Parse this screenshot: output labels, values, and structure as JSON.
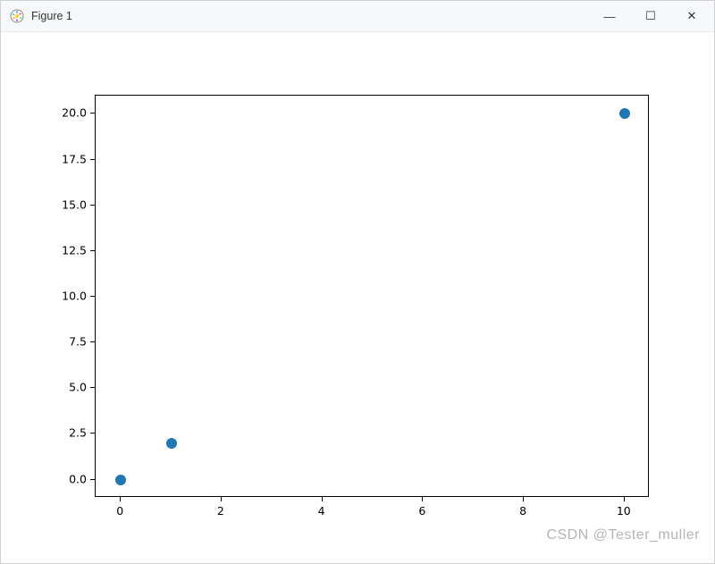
{
  "window": {
    "title": "Figure 1",
    "controls": {
      "minimize_glyph": "—",
      "maximize_glyph": "☐",
      "close_glyph": "✕"
    }
  },
  "watermark": "CSDN @Tester_muller",
  "axes": {
    "x_ticks": [
      "0",
      "2",
      "4",
      "6",
      "8",
      "10"
    ],
    "y_ticks": [
      "0.0",
      "2.5",
      "5.0",
      "7.5",
      "10.0",
      "12.5",
      "15.0",
      "17.5",
      "20.0"
    ]
  },
  "chart_data": {
    "type": "scatter",
    "x": [
      0,
      1,
      10
    ],
    "y": [
      0,
      2,
      20
    ],
    "title": "",
    "xlabel": "",
    "ylabel": "",
    "xlim": [
      -0.5,
      10.5
    ],
    "ylim": [
      -1.0,
      21.0
    ],
    "color": "#1f77b4",
    "grid": false,
    "legend": null
  }
}
